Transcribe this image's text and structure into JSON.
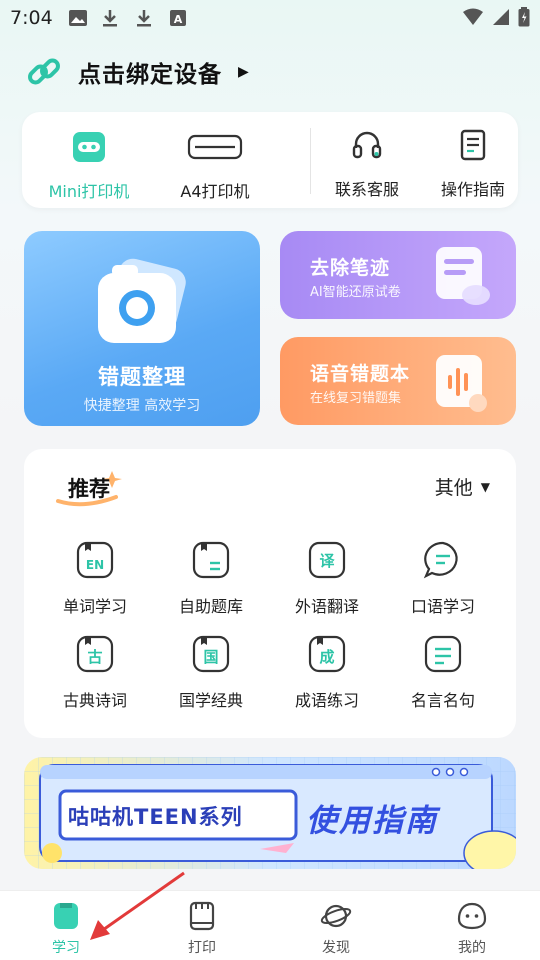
{
  "status_bar": {
    "time": "7:04"
  },
  "bind_device": {
    "label": "点击绑定设备"
  },
  "devices": [
    {
      "label": "Mini打印机",
      "active": true
    },
    {
      "label": "A4打印机",
      "active": false
    }
  ],
  "services": [
    {
      "label": "联系客服"
    },
    {
      "label": "操作指南"
    }
  ],
  "features": {
    "mistakes": {
      "title": "错题整理",
      "subtitle": "快捷整理 高效学习"
    },
    "erase": {
      "title": "去除笔迹",
      "subtitle": "AI智能还原试卷"
    },
    "voice": {
      "title": "语音错题本",
      "subtitle": "在线复习错题集"
    }
  },
  "recommend": {
    "title": "推荐",
    "other_label": "其他",
    "items": [
      {
        "label": "单词学习",
        "icon": "EN"
      },
      {
        "label": "自助题库",
        "icon": "book"
      },
      {
        "label": "外语翻译",
        "icon": "译"
      },
      {
        "label": "口语学习",
        "icon": "chat"
      },
      {
        "label": "古典诗词",
        "icon": "古"
      },
      {
        "label": "国学经典",
        "icon": "国"
      },
      {
        "label": "成语练习",
        "icon": "成"
      },
      {
        "label": "名言名句",
        "icon": "quote"
      }
    ]
  },
  "banner": {
    "left_text": "咕咕机TEEN系列",
    "right_text": "使用指南"
  },
  "tabbar": [
    {
      "label": "学习",
      "active": true
    },
    {
      "label": "打印",
      "active": false
    },
    {
      "label": "发现",
      "active": false
    },
    {
      "label": "我的",
      "active": false
    }
  ],
  "colors": {
    "accent": "#2dc4a7"
  }
}
